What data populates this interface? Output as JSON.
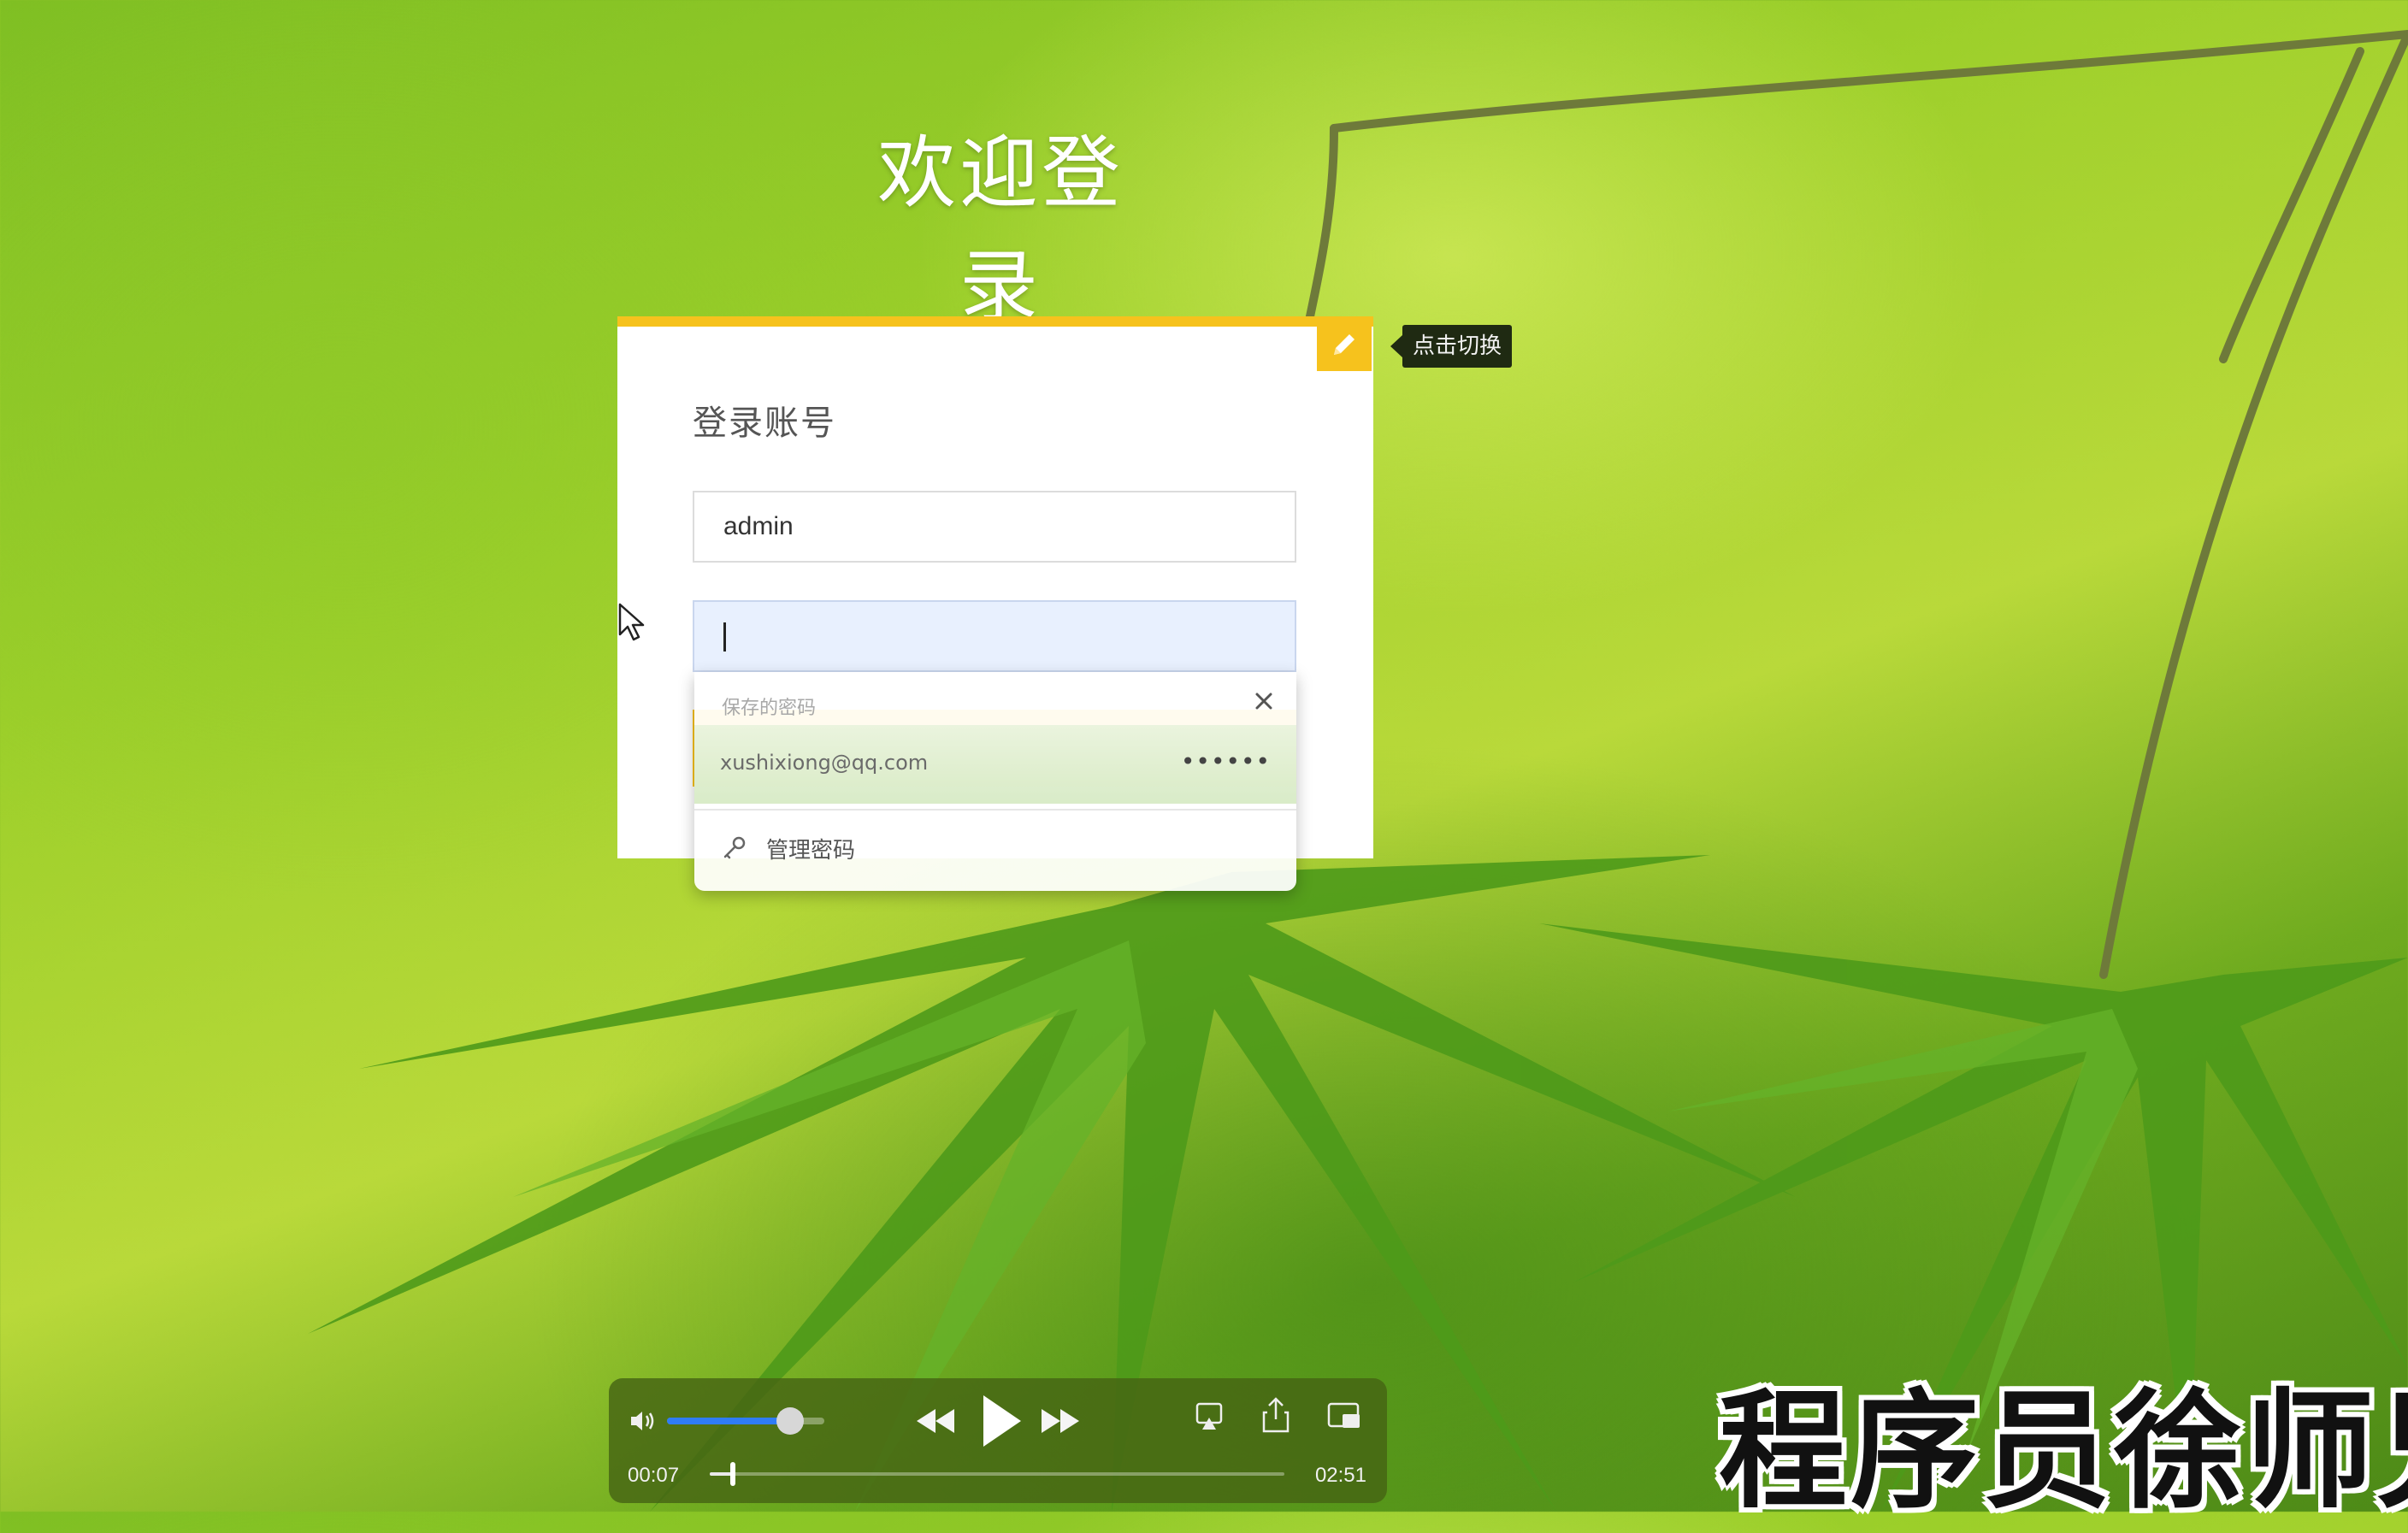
{
  "page": {
    "title": "欢迎登录"
  },
  "card": {
    "heading": "登录账号",
    "edit_icon": "pencil-icon",
    "tooltip": "点击切换",
    "username_value": "admin",
    "password_value": ""
  },
  "autofill": {
    "header": "保存的密码",
    "close_icon": "close-icon",
    "saved_email": "xushixiong@qq.com",
    "saved_password_mask": "••••••",
    "manage_icon": "key-icon",
    "manage_label": "管理密码"
  },
  "player": {
    "current_time": "00:07",
    "total_time": "02:51",
    "progress_fraction": 0.04,
    "volume_fraction": 0.78,
    "icons": [
      "volume-icon",
      "rewind-icon",
      "play-icon",
      "fast-forward-icon",
      "airplay-icon",
      "share-icon",
      "picture-in-picture-icon"
    ]
  },
  "watermark": "程序员徐师兄",
  "colors": {
    "accent": "#f6c21d",
    "volume": "#2f7cf6",
    "tooltip_bg": "#1f2a12"
  }
}
